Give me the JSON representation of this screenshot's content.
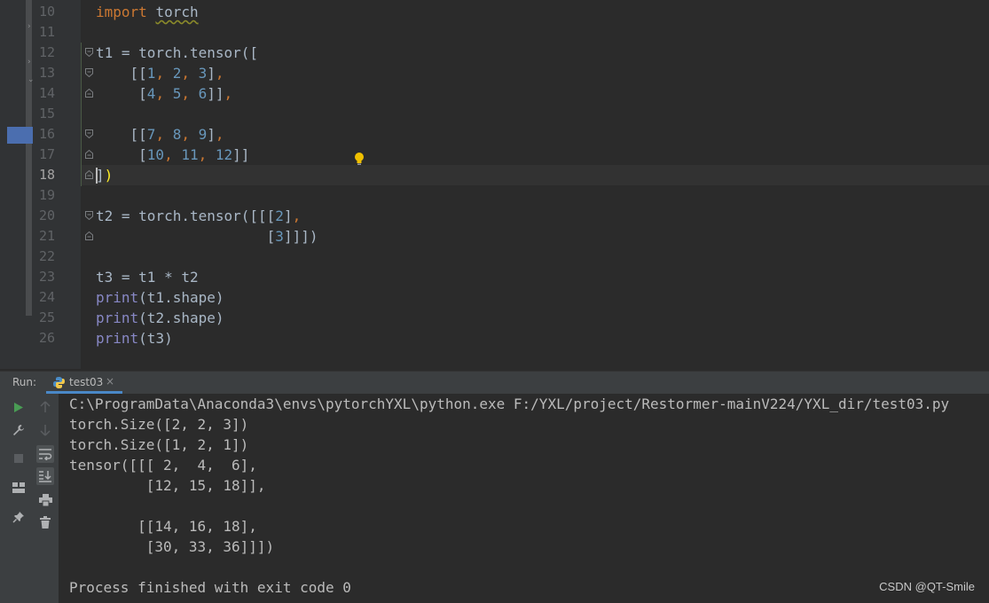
{
  "editor": {
    "lines": [
      {
        "num": "10",
        "html_key": "l10"
      },
      {
        "num": "11"
      },
      {
        "num": "12"
      },
      {
        "num": "13"
      },
      {
        "num": "14"
      },
      {
        "num": "15"
      },
      {
        "num": "16"
      },
      {
        "num": "17"
      },
      {
        "num": "18"
      },
      {
        "num": "19"
      },
      {
        "num": "20"
      },
      {
        "num": "21"
      },
      {
        "num": "22"
      },
      {
        "num": "23"
      },
      {
        "num": "24"
      },
      {
        "num": "25"
      },
      {
        "num": "26"
      }
    ],
    "code": {
      "l10_kw": "import",
      "l10_mod": "torch",
      "l12_a": "t1 = torch.tensor(",
      "l12_b": "[",
      "l13_indent": "    [[",
      "l13_n1": "1",
      "l13_n2": "2",
      "l13_n3": "3",
      "l14_indent": "     [",
      "l14_n1": "4",
      "l14_n2": "5",
      "l14_n3": "6",
      "l16_indent": "    [[",
      "l16_n1": "7",
      "l16_n2": "8",
      "l16_n3": "9",
      "l17_indent": "     [",
      "l17_n1": "10",
      "l17_n2": "11",
      "l17_n3": "12",
      "l18_a": "]",
      "l18_b": ")",
      "l20_a": "t2 = torch.tensor([[[",
      "l20_n": "2",
      "l21_indent": "                    [",
      "l21_n": "3",
      "l21_end": "]]])",
      "l23": "t3 = t1 * t2",
      "l24_fn": "print",
      "l24_rest": "(t1.shape)",
      "l25_fn": "print",
      "l25_rest": "(t2.shape)",
      "l26_fn": "print",
      "l26_rest": "(t3)"
    }
  },
  "run": {
    "label": "Run:",
    "tab_name": "test03",
    "tab_close": "×",
    "console": [
      "C:\\ProgramData\\Anaconda3\\envs\\pytorchYXL\\python.exe F:/YXL/project/Restormer-mainV224/YXL_dir/test03.py",
      "torch.Size([2, 2, 3])",
      "torch.Size([1, 2, 1])",
      "tensor([[[ 2,  4,  6],",
      "         [12, 15, 18]],",
      "",
      "        [[14, 16, 18],",
      "         [30, 33, 36]]])",
      "",
      "Process finished with exit code 0"
    ]
  },
  "watermark": "CSDN @QT-Smile",
  "colors": {
    "editor_bg": "#2b2b2b",
    "keyword": "#cc7832",
    "number": "#6897bb",
    "builtin": "#8888c6",
    "text": "#a9b7c6",
    "accent_tab": "#4a88c7"
  },
  "icons": [
    "run-icon",
    "wrench-icon",
    "stop-icon",
    "layout-icon",
    "pin-icon",
    "arrow-up-icon",
    "arrow-down-icon",
    "soft-wrap-icon",
    "scroll-to-end-icon",
    "print-icon",
    "trash-icon",
    "lightbulb-icon",
    "python-icon"
  ]
}
